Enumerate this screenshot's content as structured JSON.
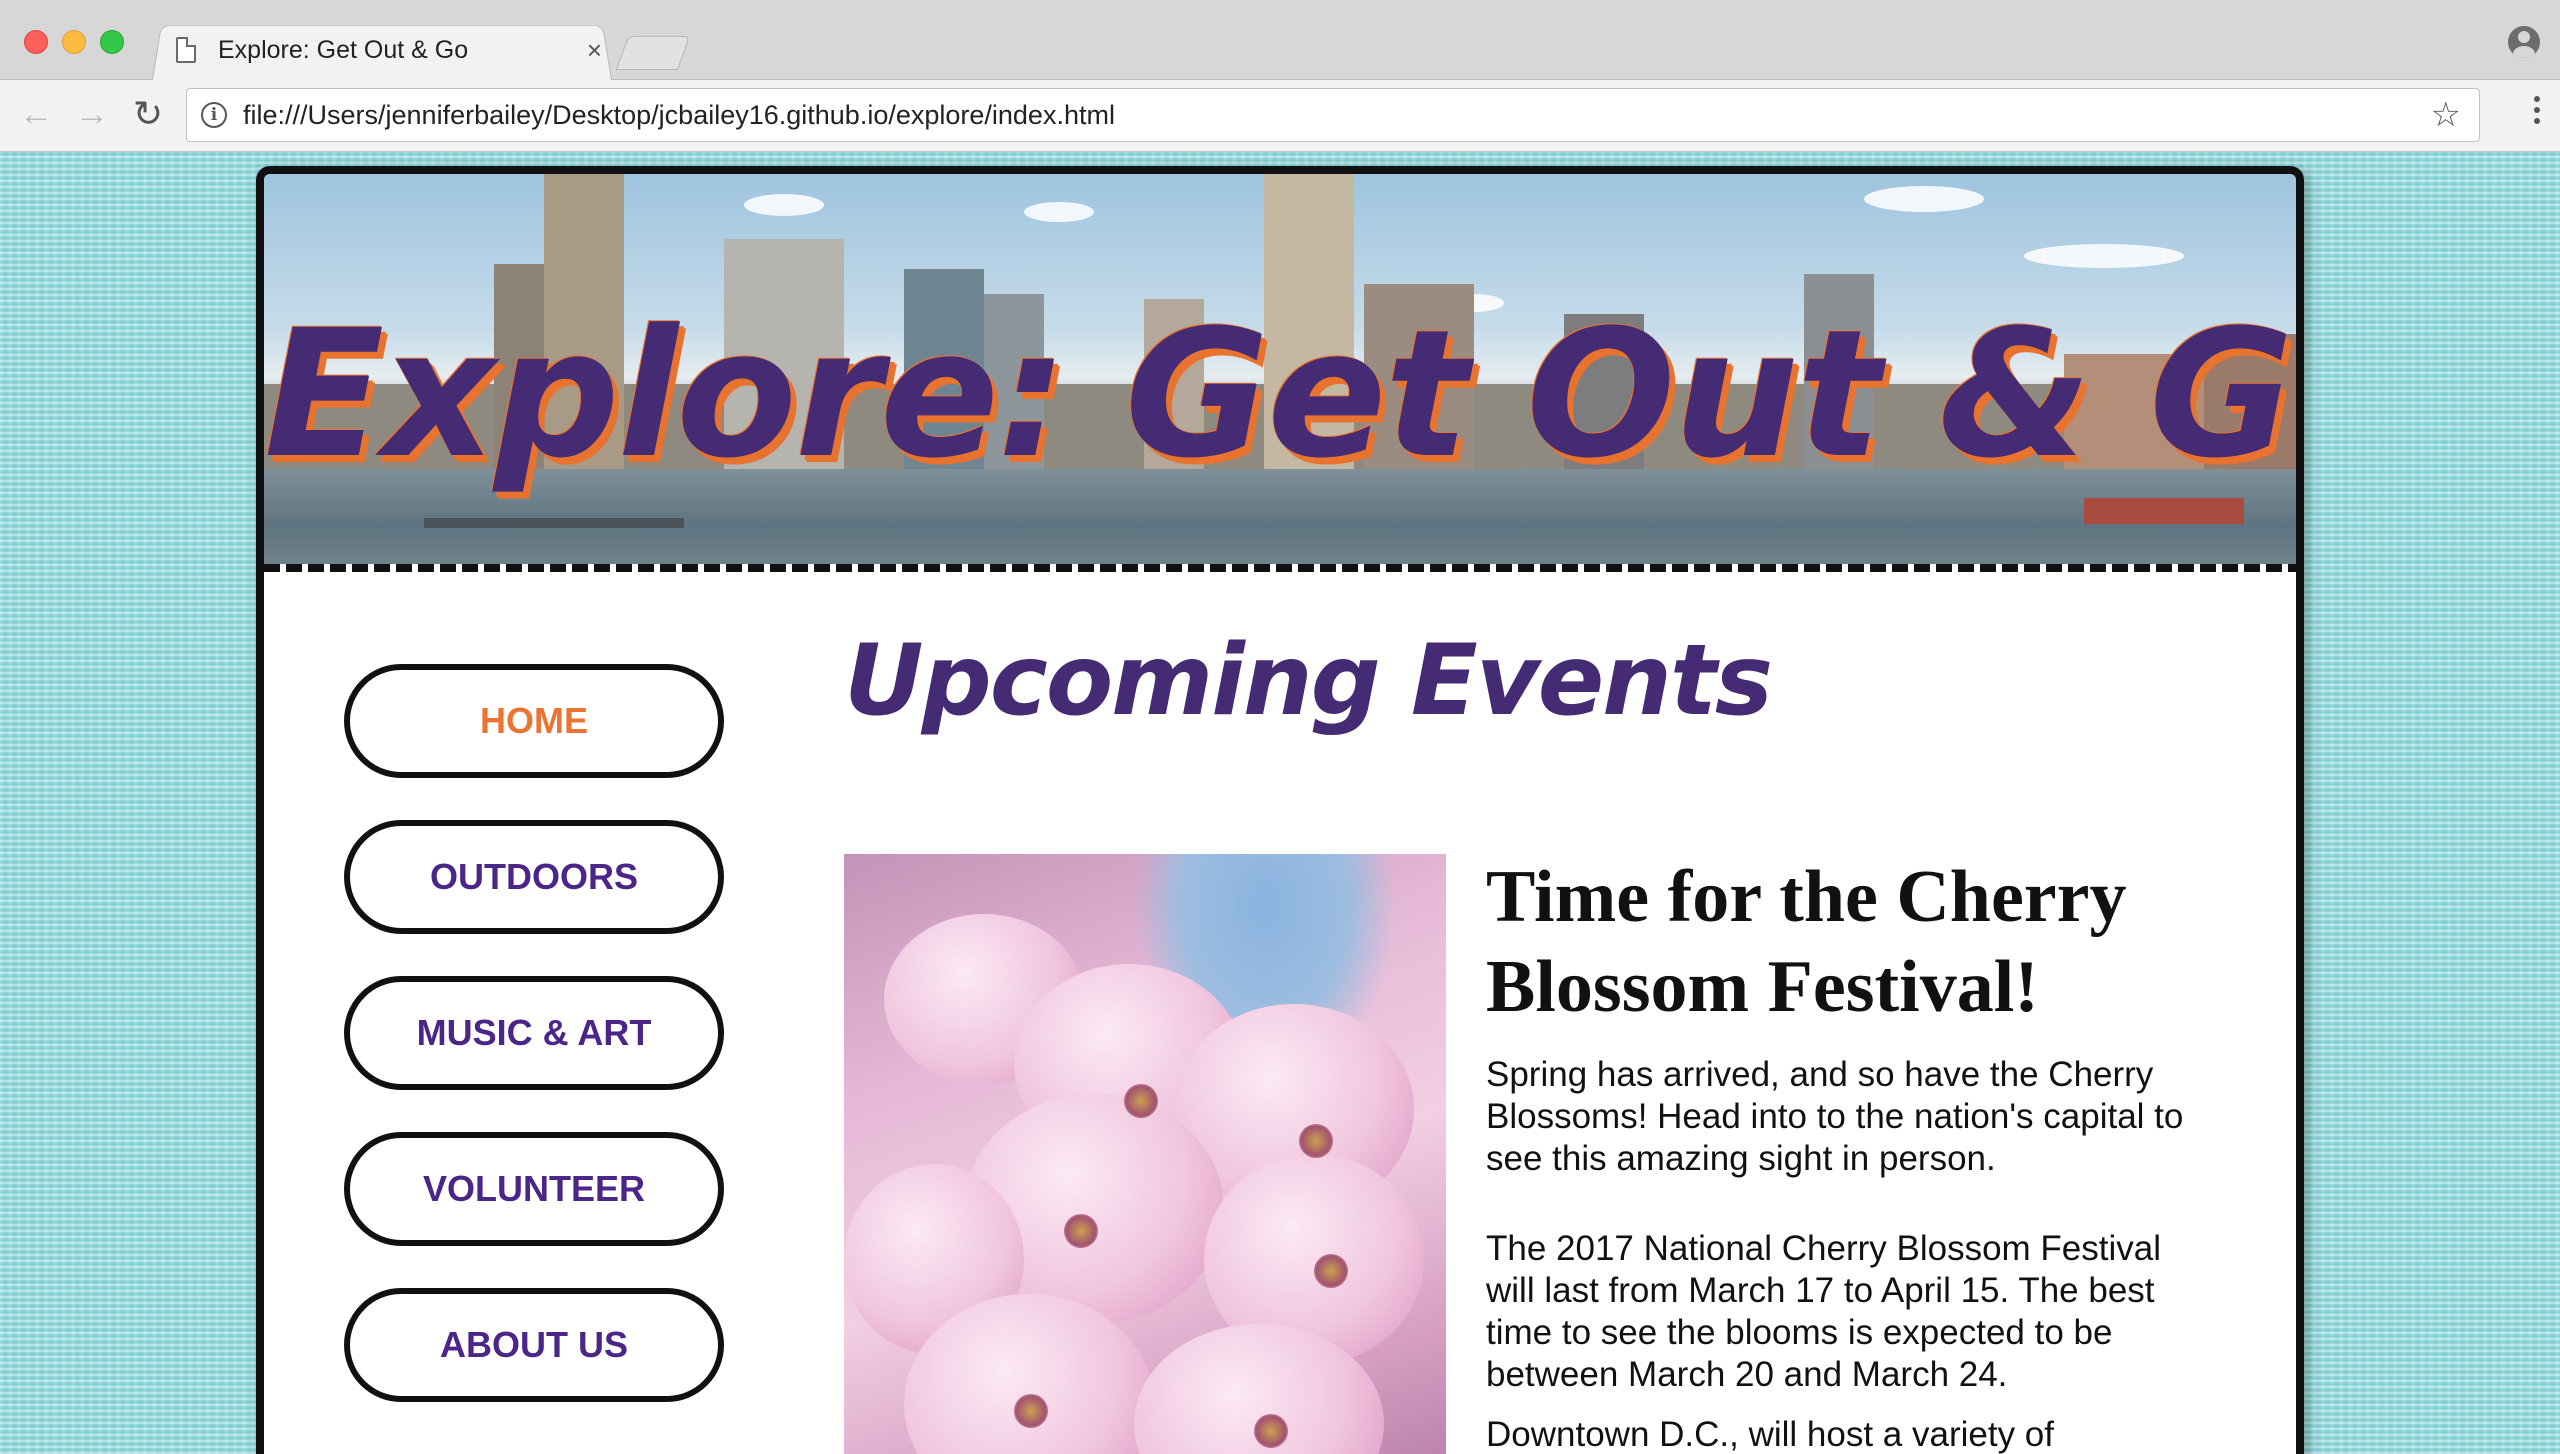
{
  "browser": {
    "tab_title": "Explore: Get Out & Go",
    "tab_close": "×",
    "url": "file:///Users/jenniferbailey/Desktop/jcbailey16.github.io/explore/index.html",
    "back_icon": "←",
    "forward_icon": "→",
    "reload_icon": "↻",
    "info_icon": "i",
    "star_icon": "☆"
  },
  "site": {
    "banner_title": "Explore: Get Out & Go",
    "nav": [
      {
        "label": "HOME",
        "active": true
      },
      {
        "label": "OUTDOORS",
        "active": false
      },
      {
        "label": "MUSIC & ART",
        "active": false
      },
      {
        "label": "VOLUNTEER",
        "active": false
      },
      {
        "label": "ABOUT US",
        "active": false
      }
    ],
    "heading": "Upcoming Events",
    "event": {
      "title": "Time for the Cherry Blossom Festival!",
      "paragraphs": [
        "Spring has arrived, and so have the Cherry Blossoms! Head into to the nation's capital to see this amazing sight in person.",
        "The 2017 National Cherry Blossom Festival will last from March 17 to April 15. The best time to see the blooms is expected to be between March 20 and March 24.",
        "Downtown D.C., will host a variety of"
      ]
    }
  },
  "colors": {
    "purple": "#452b73",
    "nav_purple": "#4b2587",
    "orange": "#ec7433",
    "page_background": "#93dcde"
  }
}
